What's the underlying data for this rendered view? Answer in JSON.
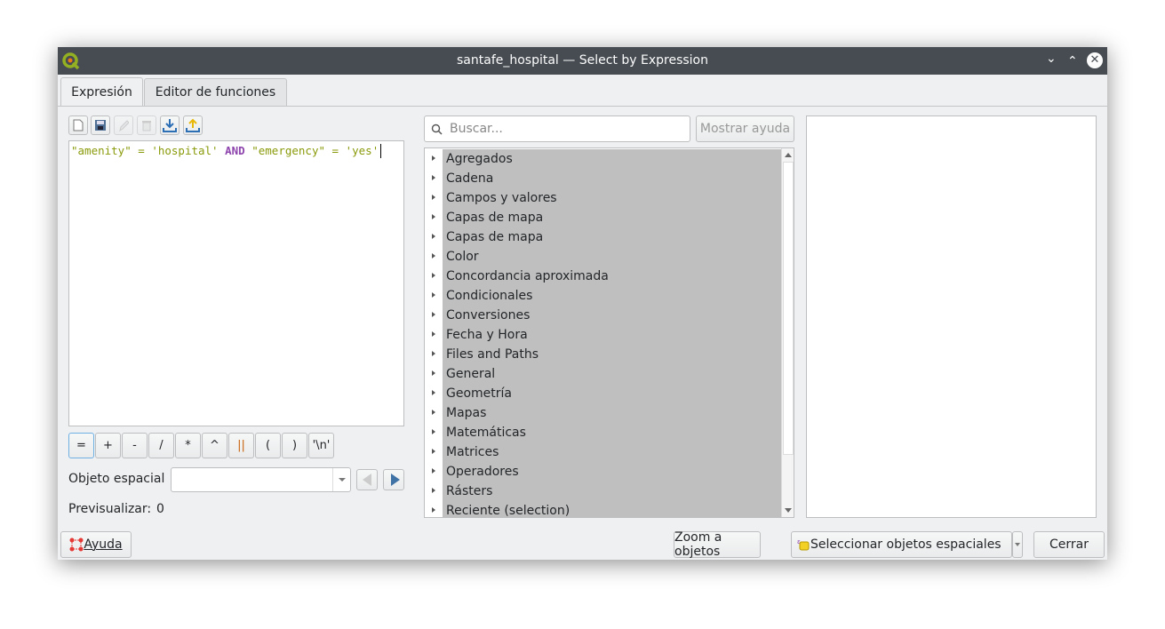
{
  "window": {
    "title": "santafe_hospital — Select by Expression"
  },
  "tabs": [
    {
      "label": "Expresión",
      "active": true
    },
    {
      "label": "Editor de funciones",
      "active": false
    }
  ],
  "toolbar": {
    "icons": [
      "new-file-icon",
      "save-icon",
      "edit-icon",
      "delete-icon",
      "import-icon",
      "export-icon"
    ]
  },
  "editor": {
    "tokens": [
      {
        "text": "\"amenity\"",
        "color": "#8a9a0a"
      },
      {
        "text": " = ",
        "color": "#8a9a0a"
      },
      {
        "text": "'hospital'",
        "color": "#8a9a0a"
      },
      {
        "text": " AND ",
        "color": "#8e44ad"
      },
      {
        "text": "\"emergency\"",
        "color": "#8a9a0a"
      },
      {
        "text": " = ",
        "color": "#8a9a0a"
      },
      {
        "text": "'yes'",
        "color": "#8a9a0a"
      }
    ]
  },
  "operators": [
    "=",
    "+",
    "-",
    "/",
    "*",
    "^",
    "||",
    "(",
    ")",
    "'\\n'"
  ],
  "feature": {
    "label": "Objeto espacial",
    "value": ""
  },
  "preview": {
    "label": "Previsualizar:",
    "value": "0"
  },
  "search": {
    "placeholder": "Buscar...",
    "help_button": "Mostrar ayuda"
  },
  "tree": [
    "Agregados",
    "Cadena",
    "Campos y valores",
    "Capas de mapa",
    "Capas de mapa",
    "Color",
    "Concordancia aproximada",
    "Condicionales",
    "Conversiones",
    "Fecha y Hora",
    "Files and Paths",
    "General",
    "Geometría",
    "Mapas",
    "Matemáticas",
    "Matrices",
    "Operadores",
    "Rásters",
    "Reciente (selection)"
  ],
  "buttons": {
    "help": "Ayuda",
    "zoom": "Zoom a objetos",
    "select": "Seleccionar objetos espaciales",
    "close": "Cerrar"
  }
}
